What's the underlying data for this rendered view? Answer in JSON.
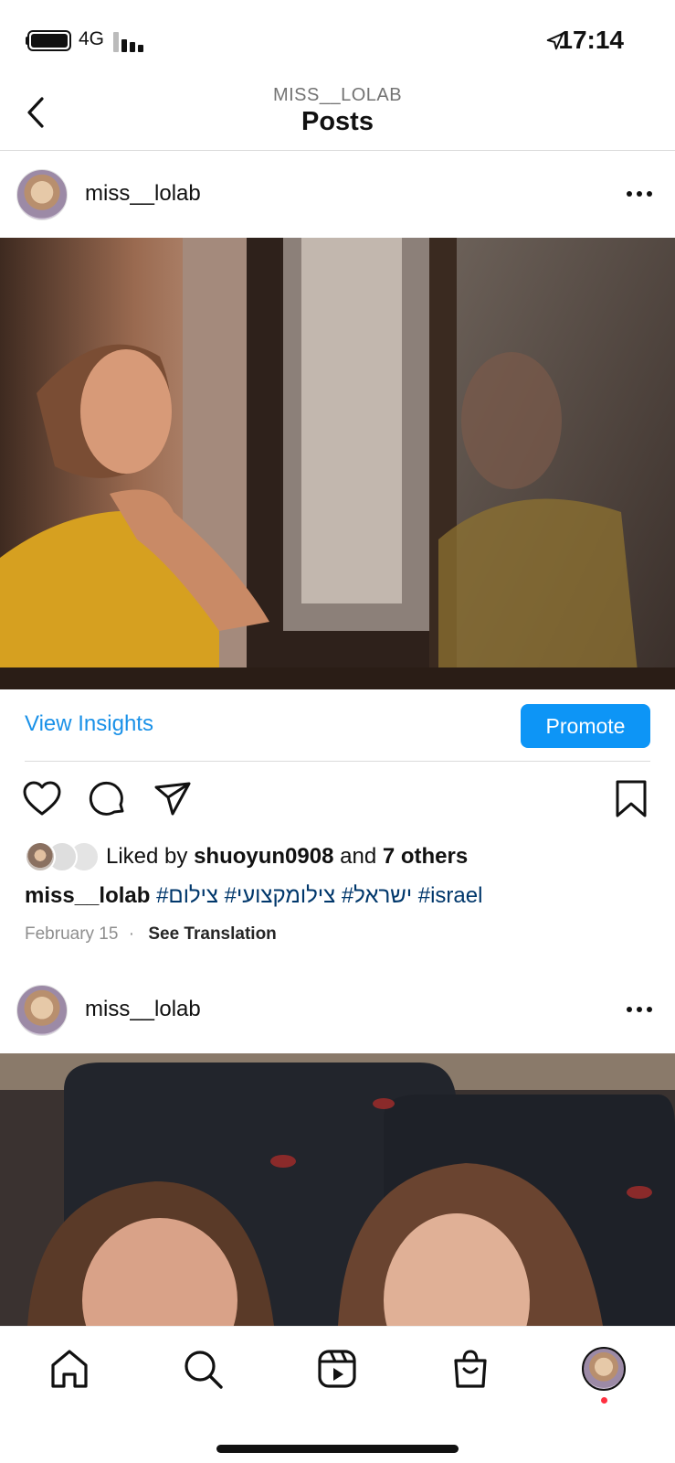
{
  "status_bar": {
    "network": "4G",
    "time": "17:14"
  },
  "header": {
    "account": "MISS__LOLAB",
    "title": "Posts"
  },
  "posts": [
    {
      "username": "miss__lolab",
      "insights_label": "View Insights",
      "promote_label": "Promote",
      "likes": {
        "prefix": "Liked by ",
        "user": "shuoyun0908",
        "middle": " and ",
        "others": "7 others"
      },
      "caption": {
        "username": "miss__lolab",
        "text": " #ישראל# צילומקצועי# צילום #israel"
      },
      "date": "February 15",
      "separator": "·",
      "translate_label": "See Translation"
    },
    {
      "username": "miss__lolab"
    }
  ],
  "icons": {
    "back": "back-chevron-icon",
    "more": "more-horizontal-icon",
    "like": "heart-icon",
    "comment": "comment-icon",
    "share": "send-icon",
    "save": "bookmark-icon",
    "tabs": [
      "home-icon",
      "search-icon",
      "reels-icon",
      "shop-icon",
      "profile-avatar"
    ]
  },
  "colors": {
    "link_blue": "#1a91e8",
    "promote_bg": "#0d95f6",
    "hashtag": "#00376b",
    "notification": "#ff3040"
  }
}
